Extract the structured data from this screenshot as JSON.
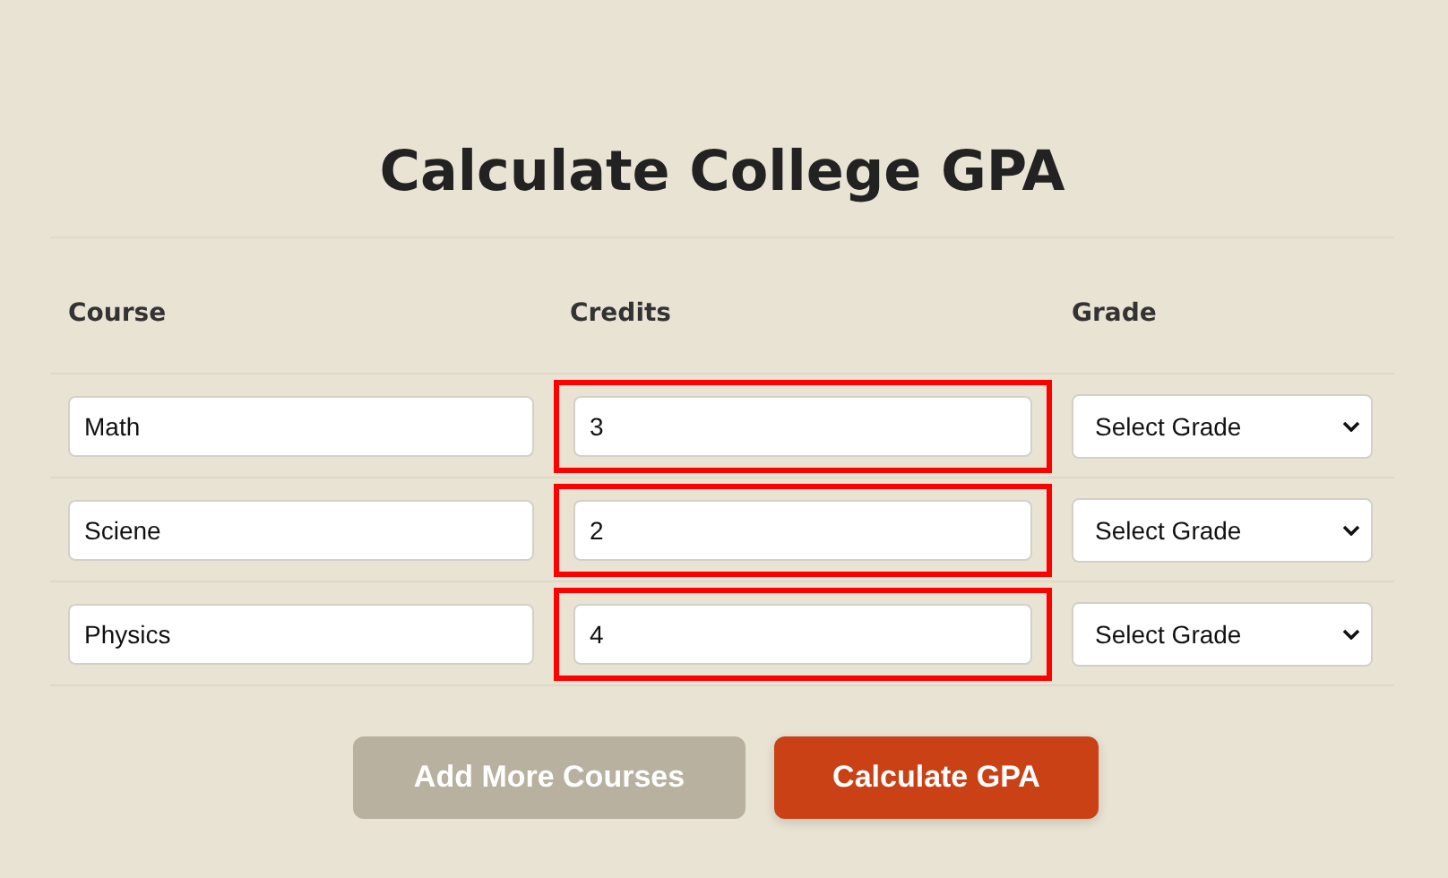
{
  "title": "Calculate College GPA",
  "columns": [
    "Course",
    "Credits",
    "Grade"
  ],
  "rows": [
    {
      "course": "Math",
      "credits": "3",
      "credits_highlighted": true,
      "grade": "Select Grade"
    },
    {
      "course": "Sciene",
      "credits": "2",
      "credits_highlighted": true,
      "grade": "Select Grade"
    },
    {
      "course": "Physics",
      "credits": "4",
      "credits_highlighted": true,
      "grade": "Select Grade"
    }
  ],
  "buttons": [
    {
      "label": "Add More Courses",
      "kind": "secondary"
    },
    {
      "label": "Calculate GPA",
      "kind": "primary"
    }
  ]
}
